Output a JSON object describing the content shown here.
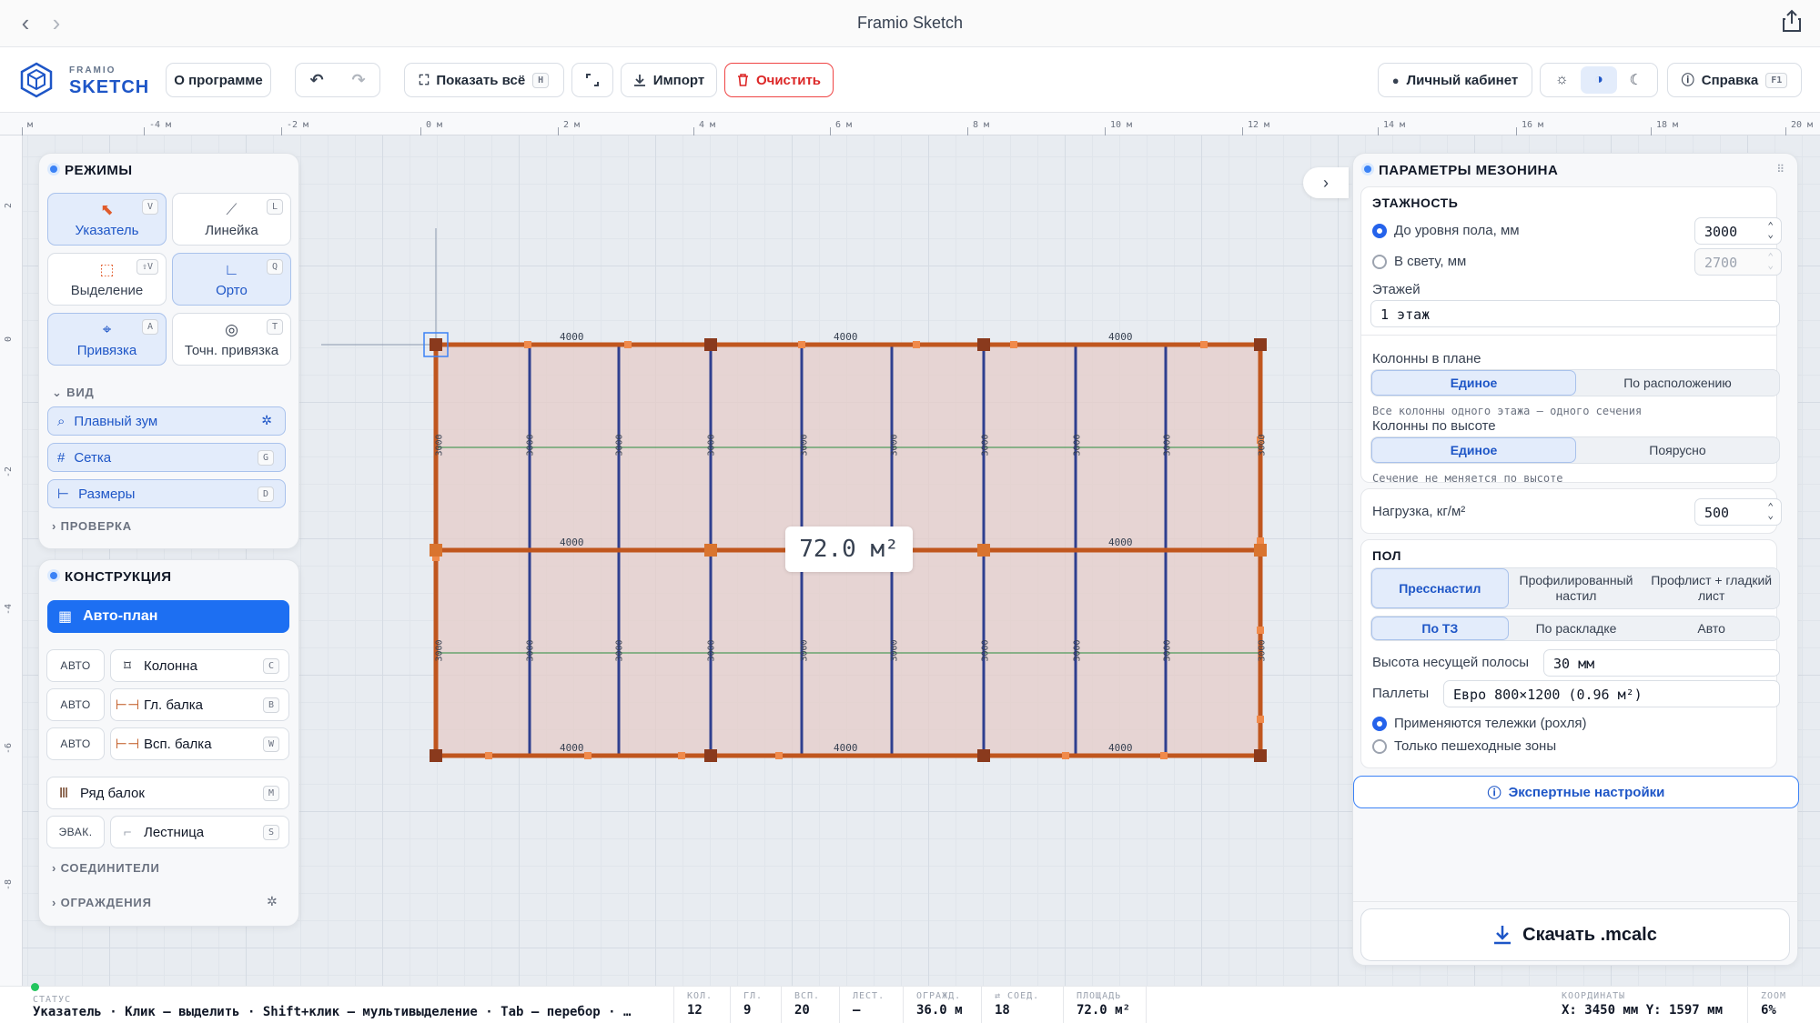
{
  "window": {
    "title": "Framio Sketch"
  },
  "brand": {
    "small": "FRAMIO",
    "big": "SKETCH"
  },
  "toolbar": {
    "about": "О программе",
    "show_all": "Показать всё",
    "show_all_key": "H",
    "import": "Импорт",
    "clear": "Очистить",
    "account": "Личный кабинет",
    "help": "Справка",
    "help_key": "F1"
  },
  "ruler": {
    "top": [
      "м",
      "-4 м",
      "-2 м",
      "0 м",
      "2 м",
      "4 м",
      "6 м",
      "8 м",
      "10 м",
      "12 м",
      "14 м",
      "16 м",
      "18 м",
      "20 м"
    ],
    "left": [
      "2",
      "0",
      "-2",
      "-4",
      "-6",
      "-8"
    ]
  },
  "modes": {
    "title": "РЕЖИМЫ",
    "items": [
      {
        "label": "Указатель",
        "key": "V"
      },
      {
        "label": "Линейка",
        "key": "L"
      },
      {
        "label": "Выделение",
        "key": "⇧V"
      },
      {
        "label": "Орто",
        "key": "Q"
      },
      {
        "label": "Привязка",
        "key": "A"
      },
      {
        "label": "Точн. привязка",
        "key": "T"
      }
    ],
    "view_title": "ВИД",
    "view": [
      {
        "label": "Плавный зум",
        "key": ""
      },
      {
        "label": "Сетка",
        "key": "G"
      },
      {
        "label": "Размеры",
        "key": "D"
      }
    ],
    "check_title": "ПРОВЕРКА"
  },
  "construction": {
    "title": "КОНСТРУКЦИЯ",
    "autoplan": "Авто-план",
    "auto_tag": "АВТО",
    "evac_tag": "ЭВАК.",
    "items": [
      {
        "label": "Колонна",
        "key": "C"
      },
      {
        "label": "Гл. балка",
        "key": "B"
      },
      {
        "label": "Всп. балка",
        "key": "W"
      },
      {
        "label": "Ряд балок",
        "key": "M"
      },
      {
        "label": "Лестница",
        "key": "S"
      }
    ],
    "connectors": "СОЕДИНИТЕЛИ",
    "fences": "ОГРАЖДЕНИЯ"
  },
  "drawing": {
    "area": "72.0 м²",
    "dim_h": "4000",
    "dim_v": "3000"
  },
  "params": {
    "title": "ПАРАМЕТРЫ МЕЗОНИНА",
    "floors_title": "ЭТАЖНОСТЬ",
    "to_floor_label": "До уровня пола, мм",
    "to_floor_value": "3000",
    "clear_height_label": "В свету, мм",
    "clear_height_value": "2700",
    "floors_label": "Этажей",
    "floors_value": "1 этаж",
    "columns_plan_label": "Колонны в плане",
    "columns_plan_options": [
      "Единое",
      "По расположению"
    ],
    "columns_plan_hint": "Все колонны одного этажа — одного сечения",
    "columns_height_label": "Колонны по высоте",
    "columns_height_options": [
      "Единое",
      "Поярусно"
    ],
    "columns_height_hint": "Сечение не меняется по высоте",
    "load_label": "Нагрузка, кг/м²",
    "load_value": "500",
    "floor_title": "ПОЛ",
    "floor_options": [
      "Пресснастил",
      "Профилированный настил",
      "Профлист + гладкий лист"
    ],
    "layout_options": [
      "По ТЗ",
      "По раскладке",
      "Авто"
    ],
    "strip_label": "Высота несущей полосы",
    "strip_value": "30 мм",
    "pallets_label": "Паллеты",
    "pallets_value": "Евро 800×1200 (0.96 м²)",
    "trolley_label": "Применяются тележки (рохля)",
    "walk_label": "Только пешеходные зоны",
    "expert": "Экспертные настройки",
    "download": "Скачать .mcalc"
  },
  "status": {
    "label": "СТАТУС",
    "text": "Указатель · Клик — выделить · Shift+клик — мультивыделение · Tab — перебор · …",
    "cells": [
      {
        "t": "КОЛ.",
        "v": "12"
      },
      {
        "t": "ГЛ.",
        "v": "9"
      },
      {
        "t": "ВСП.",
        "v": "20"
      },
      {
        "t": "ЛЕСТ.",
        "v": "–"
      },
      {
        "t": "ОГРАЖД.",
        "v": "36.0 м"
      },
      {
        "t": "⇄ СОЕД.",
        "v": "18"
      },
      {
        "t": "ПЛОЩАДЬ",
        "v": "72.0 м²"
      }
    ],
    "coords_label": "КООРДИНАТЫ",
    "coords": "X: 3450 мм Y: 1597 мм",
    "zoom_label": "ZOOM",
    "zoom": "6%"
  }
}
